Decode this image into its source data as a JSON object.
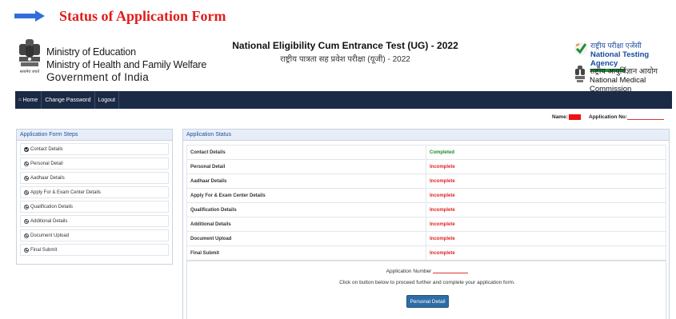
{
  "caption": {
    "title": "Status of Application Form",
    "arrow_icon": "right-arrow-icon",
    "arrow_color": "#2f6fdc",
    "title_color": "#e21b1b"
  },
  "header": {
    "emblem_motto": "सत्यमेव जयते",
    "ministry": [
      "Ministry of Education",
      "Ministry of Health and Family Welfare",
      "Government of India"
    ],
    "exam_title_en": "National Eligibility Cum Entrance Test (UG) - 2022",
    "exam_title_hi": "राष्ट्रीय पात्रता सह प्रवेश परीक्षा (यूजी) - 2022",
    "nta_hi": "राष्ट्रीय परीक्षा एजेंसी",
    "nta_en": "National Testing Agency",
    "nmc_hi": "राष्ट्रीय आयुर्विज्ञान आयोग",
    "nmc_en": "National Medical Commission"
  },
  "nav": {
    "home": "Home",
    "change_password": "Change Password",
    "logout": "Logout",
    "bg_color": "#1b2a45"
  },
  "user": {
    "name_label": "Name:",
    "application_no_label": "Application No:"
  },
  "steps": {
    "title": "Application Form Steps",
    "items": [
      {
        "label": "Contact Details",
        "done": true
      },
      {
        "label": "Personal Detail",
        "done": false
      },
      {
        "label": "Aadhaar Details",
        "done": false
      },
      {
        "label": "Apply For & Exam Center Details",
        "done": false
      },
      {
        "label": "Qualification Details",
        "done": false
      },
      {
        "label": "Additional Details",
        "done": false
      },
      {
        "label": "Document Upload",
        "done": false
      },
      {
        "label": "Final Submit",
        "done": false
      }
    ]
  },
  "status": {
    "title": "Application Status",
    "rows": [
      {
        "label": "Contact Details",
        "status": "Completed"
      },
      {
        "label": "Personal Detail",
        "status": "Incomplete"
      },
      {
        "label": "Aadhaar Details",
        "status": "Incomplete"
      },
      {
        "label": "Apply For & Exam Center Details",
        "status": "Incomplete"
      },
      {
        "label": "Qualification Details",
        "status": "Incomplete"
      },
      {
        "label": "Additional Details",
        "status": "Incomplete"
      },
      {
        "label": "Document Upload",
        "status": "Incomplete"
      },
      {
        "label": "Final Submit",
        "status": "Incomplete"
      }
    ],
    "complete_color": "#1f8a2b",
    "incomplete_color": "#e02222"
  },
  "info": {
    "application_number_label": "Application Number",
    "instruction": "Click on button below to proceed further and complete your application form.",
    "button_label": "Personal Detail"
  }
}
